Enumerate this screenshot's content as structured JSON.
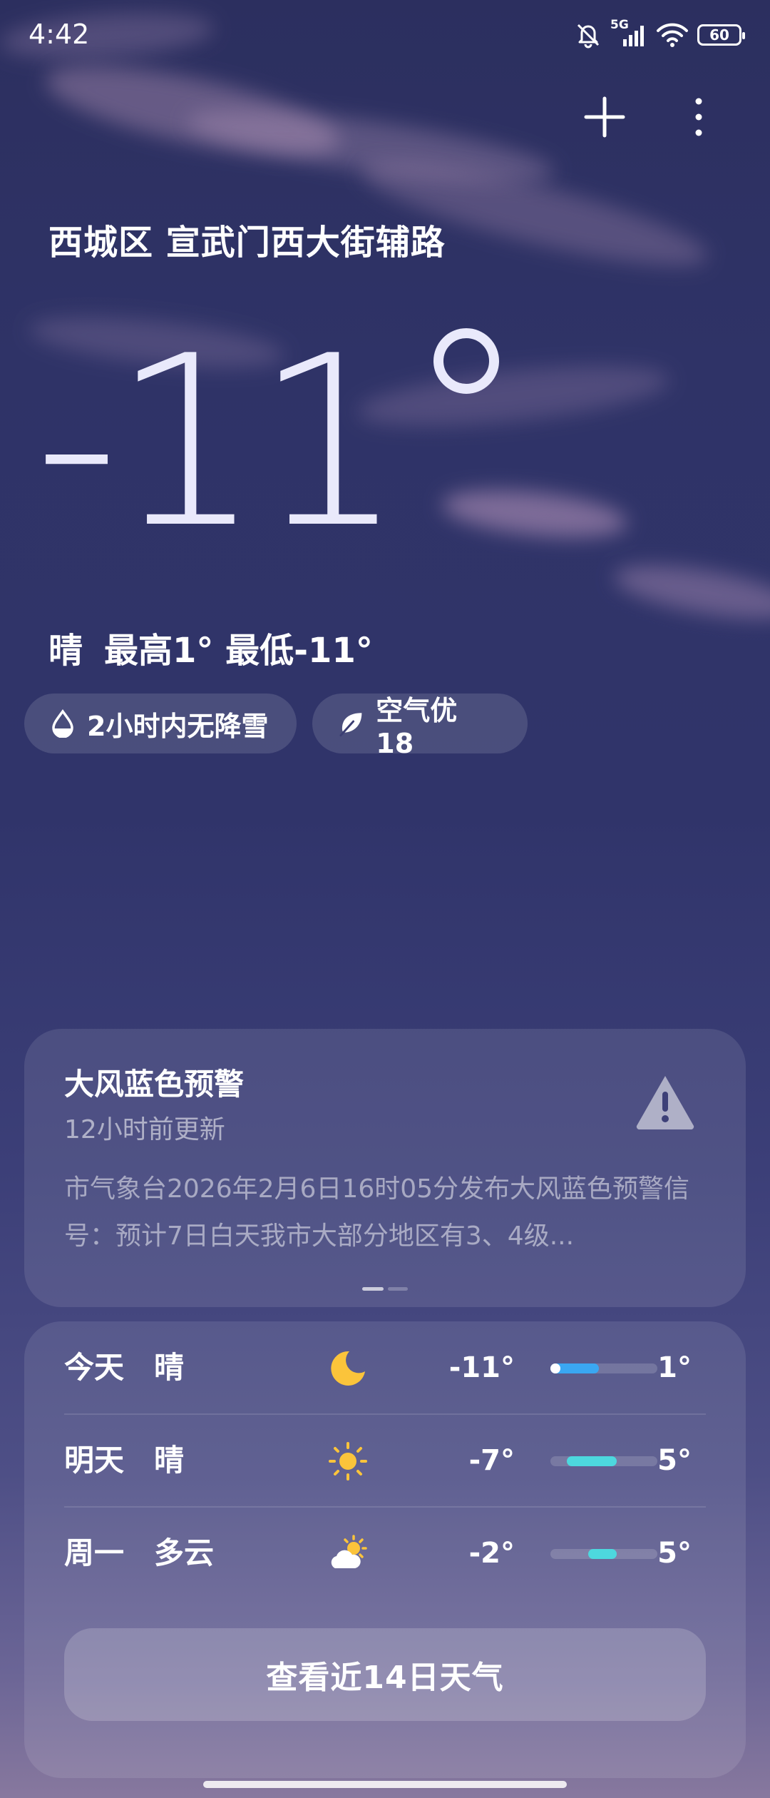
{
  "status_bar": {
    "time": "4:42",
    "network": "5G",
    "battery": "60"
  },
  "location": "西城区 宣武门西大街辅路",
  "current": {
    "temperature": "-11",
    "condition": "晴",
    "high_low": "最高1° 最低-11°"
  },
  "chips": [
    {
      "icon": "water-drop-icon",
      "label": "2小时内无降雪"
    },
    {
      "icon": "leaf-icon",
      "label": "空气优 18"
    }
  ],
  "warning": {
    "title": "大风蓝色预警",
    "updated": "12小时前更新",
    "body": "市气象台2026年2月6日16时05分发布大风蓝色预警信号：预计7日白天我市大部分地区有3、4级...",
    "page_count": 2,
    "active_page": 1
  },
  "forecast": [
    {
      "day": "今天",
      "condition": "晴",
      "icon": "moon-icon",
      "low": "-11°",
      "high": "1°",
      "fill_start": 0.0,
      "fill_end": 0.45,
      "fill_color": "#3aa7f2",
      "current_marker": true
    },
    {
      "day": "明天",
      "condition": "晴",
      "icon": "sun-icon",
      "low": "-7°",
      "high": "5°",
      "fill_start": 0.15,
      "fill_end": 0.62,
      "fill_color": "#4dd8de",
      "current_marker": false
    },
    {
      "day": "周一",
      "condition": "多云",
      "icon": "partly-cloudy-icon",
      "low": "-2°",
      "high": "5°",
      "fill_start": 0.35,
      "fill_end": 0.62,
      "fill_color": "#4dd8de",
      "current_marker": false
    }
  ],
  "forecast_button": "查看近14日天气"
}
